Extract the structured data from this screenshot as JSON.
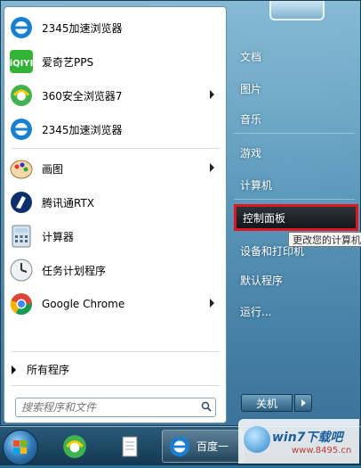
{
  "programs": [
    {
      "label": "2345加速浏览器",
      "icon": "browser-2345-icon",
      "has_arrow": false
    },
    {
      "label": "爱奇艺PPS",
      "icon": "iqiyi-icon",
      "has_arrow": false
    },
    {
      "label": "360安全浏览器7",
      "icon": "browser-360-icon",
      "has_arrow": true
    },
    {
      "label": "2345加速浏览器",
      "icon": "browser-2345-icon",
      "has_arrow": false
    },
    {
      "label": "画图",
      "icon": "paint-icon",
      "has_arrow": true
    },
    {
      "label": "腾讯通RTX",
      "icon": "rtx-icon",
      "has_arrow": false
    },
    {
      "label": "计算器",
      "icon": "calculator-icon",
      "has_arrow": false
    },
    {
      "label": "任务计划程序",
      "icon": "task-scheduler-icon",
      "has_arrow": false
    },
    {
      "label": "Google Chrome",
      "icon": "chrome-icon",
      "has_arrow": true
    }
  ],
  "all_programs": "所有程序",
  "search": {
    "placeholder": "搜索程序和文件"
  },
  "right_items": [
    {
      "label": "文档"
    },
    {
      "label": "图片"
    },
    {
      "label": "音乐"
    },
    {
      "label": "游戏"
    },
    {
      "label": "计算机"
    },
    {
      "label": "控制面板",
      "highlighted": true
    },
    {
      "label": "设备和打印机"
    },
    {
      "label": "默认程序"
    },
    {
      "label": "运行..."
    }
  ],
  "tooltip": "更改您的计算机",
  "shutdown_label": "关机",
  "taskbar": {
    "active_window_label": "百度一"
  },
  "watermark": {
    "title": "win7下载吧",
    "url": "www.8495.cn"
  },
  "colors": {
    "highlight_border": "#e0161e",
    "menu_bg": "#ffffff",
    "taskbar": "#1c4c69"
  }
}
